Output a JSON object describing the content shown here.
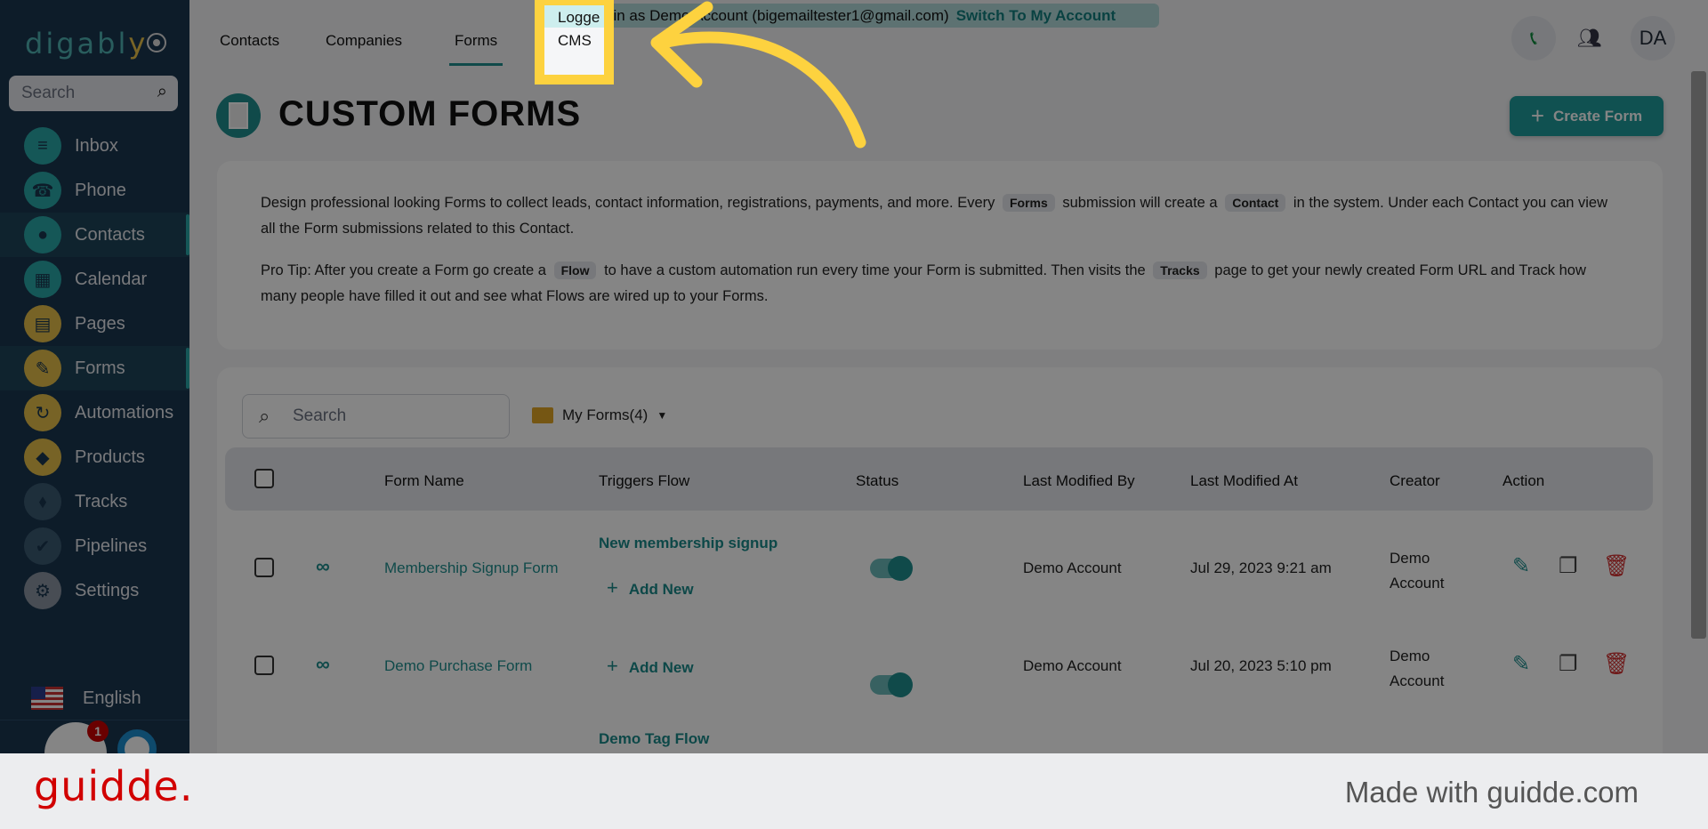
{
  "sidebar": {
    "logo": {
      "main": "digabl",
      "accent": "y"
    },
    "search_placeholder": "Search",
    "items": [
      {
        "label": "Inbox",
        "icon": "chat-icon",
        "color": "#2aa8a8"
      },
      {
        "label": "Phone",
        "icon": "phone-icon",
        "color": "#2aa8a8"
      },
      {
        "label": "Contacts",
        "icon": "person-icon",
        "color": "#2aa8a8",
        "active": true
      },
      {
        "label": "Calendar",
        "icon": "calendar-icon",
        "color": "#2aa8a8"
      },
      {
        "label": "Pages",
        "icon": "pages-icon",
        "color": "#e5bf4a"
      },
      {
        "label": "Forms",
        "icon": "pencil-icon",
        "color": "#e5bf4a",
        "active": true
      },
      {
        "label": "Automations",
        "icon": "sync-icon",
        "color": "#e5bf4a"
      },
      {
        "label": "Products",
        "icon": "tag-icon",
        "color": "#e5bf4a"
      },
      {
        "label": "Tracks",
        "icon": "route-icon",
        "color": "#3b5a72"
      },
      {
        "label": "Pipelines",
        "icon": "check-circle-icon",
        "color": "#3b5a72"
      },
      {
        "label": "Settings",
        "icon": "gear-icon",
        "color": "#8b95a1"
      }
    ],
    "language": "English",
    "notification_count": "1"
  },
  "topnav": {
    "tabs": [
      "Contacts",
      "Companies",
      "Forms"
    ],
    "active_tab": "Forms",
    "dropdown_item": "CMS",
    "banner_text": "Logged in as Demo Account (bigemailtester1@gmail.com)",
    "banner_hidden_prefix": "Logge",
    "switch_label": "Switch To My Account",
    "avatar_initials": "DA"
  },
  "page": {
    "title": "CUSTOM FORMS",
    "create_button": "Create Form",
    "info": {
      "p1a": "Design professional looking Forms to collect leads, contact information, registrations, payments, and more. Every",
      "chip1": "Forms",
      "p1b": "submission will create a",
      "chip2": "Contact",
      "p1c": "in the system. Under each Contact you can view all the Form submissions related to this Contact.",
      "p2a": "Pro Tip: After you create a Form go create a",
      "chip3": "Flow",
      "p2b": "to have a custom automation run every time your Form is submitted. Then visits the",
      "chip4": "Tracks",
      "p2c": "page to get your newly created Form URL and Track how many people have filled it out and see what Flows are wired up to your Forms."
    }
  },
  "table": {
    "search_placeholder": "Search",
    "folder_label": "My Forms(4)",
    "columns": [
      "Form Name",
      "Triggers Flow",
      "Status",
      "Last Modified By",
      "Last Modified At",
      "Creator",
      "Action"
    ],
    "add_new_label": "Add New",
    "rows": [
      {
        "name": "Membership Signup Form",
        "flow": "New membership signup",
        "status": true,
        "modified_by": "Demo Account",
        "modified_at": "Jul 29, 2023 9:21 am",
        "creator": "Demo Account"
      },
      {
        "name": "Demo Purchase Form",
        "flow": "",
        "status": true,
        "modified_by": "Demo Account",
        "modified_at": "Jul 20, 2023 5:10 pm",
        "creator": "Demo Account"
      },
      {
        "flow": "Demo Tag Flow"
      }
    ]
  },
  "footer": {
    "brand": "guidde.",
    "tagline": "Made with guidde.com"
  },
  "colors": {
    "accent": "#1f8f8f",
    "highlight": "#fdd23f",
    "danger": "#d32f2f",
    "brand_red": "#d10000"
  }
}
